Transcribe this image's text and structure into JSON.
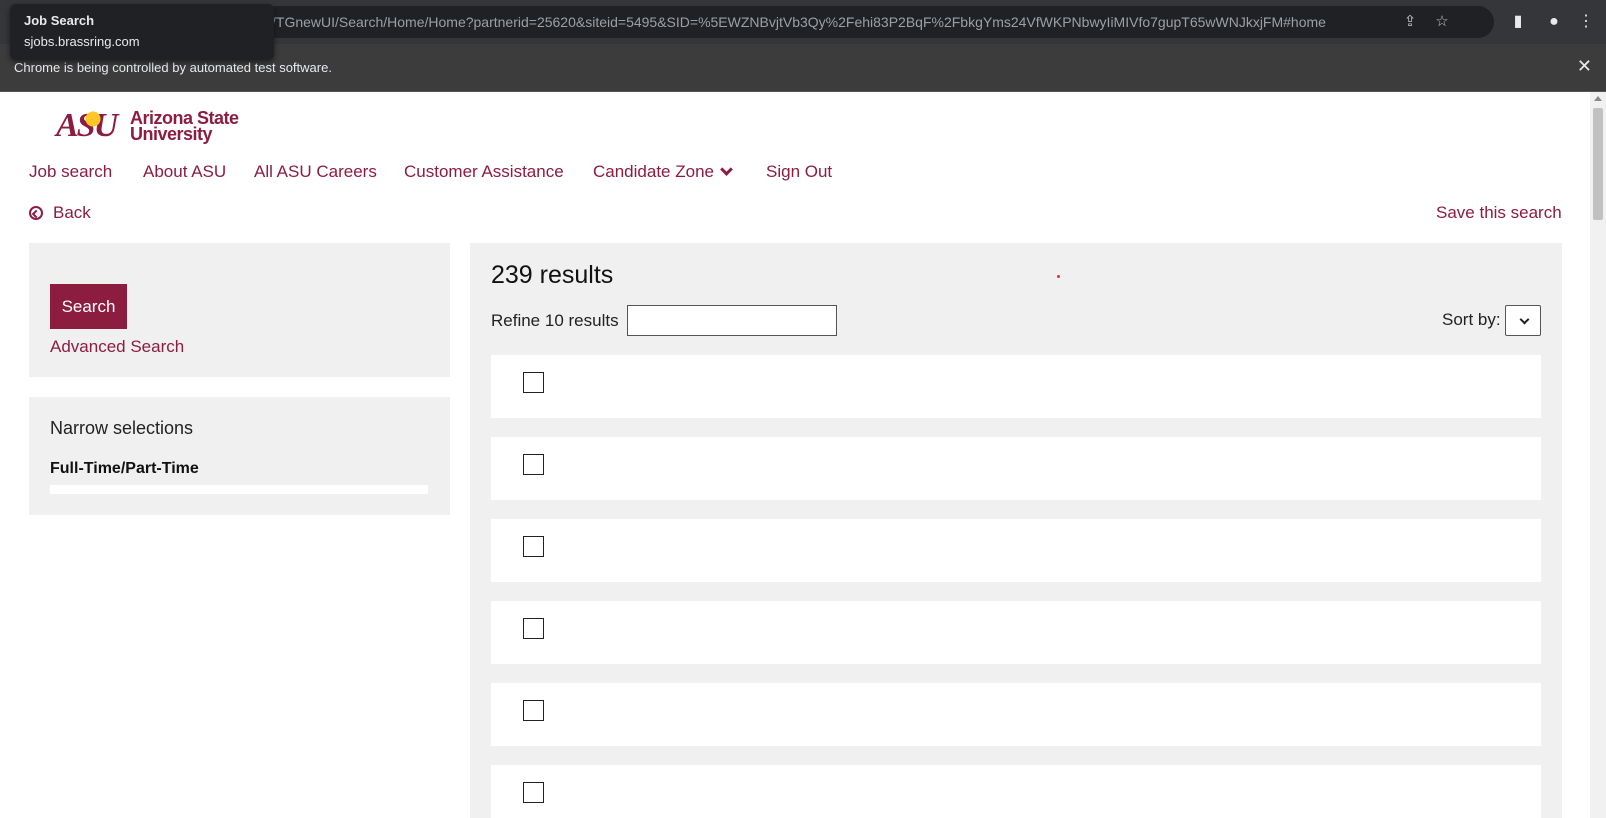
{
  "browser": {
    "tab_tooltip_title": "Job Search",
    "tab_tooltip_url": "sjobs.brassring.com",
    "address": "/TGnewUI/Search/Home/Home?partnerid=25620&siteid=5495&SID=%5EWZNBvjtVb3Qy%2Fehi83P2BqF%2FbkgYms24VfWKPNbwyIiMIVfo7gupT65wWNJkxjFM#home",
    "automation_notice": "Chrome is being controlled by automated test software.",
    "infobar_close": "✕",
    "share_icon": "⇪",
    "star_icon": "☆",
    "sidepanel_icon": "▮",
    "profile_icon": "●",
    "menu_icon": "⋮"
  },
  "logo": {
    "mark": "ASU",
    "name_line1": "Arizona State",
    "name_line2": "University"
  },
  "nav": {
    "items": [
      {
        "label": "Job search"
      },
      {
        "label": "About ASU"
      },
      {
        "label": "All ASU Careers"
      },
      {
        "label": "Customer Assistance"
      },
      {
        "label": "Candidate Zone"
      },
      {
        "label": "Sign Out"
      }
    ]
  },
  "actions": {
    "back_label": "Back",
    "save_search_label": "Save this search"
  },
  "search_panel": {
    "search_button": "Search",
    "advanced_search": "Advanced Search"
  },
  "narrow_panel": {
    "title": "Narrow selections",
    "facet_title": "Full-Time/Part-Time"
  },
  "results": {
    "count_text": "239 results",
    "refine_label": "Refine 10 results",
    "refine_value": "",
    "sort_label": "Sort by:",
    "sort_value": ""
  },
  "colors": {
    "brand_maroon": "#8c1d40",
    "brand_gold": "#ffc627",
    "panel_gray": "#f0f0f0"
  }
}
